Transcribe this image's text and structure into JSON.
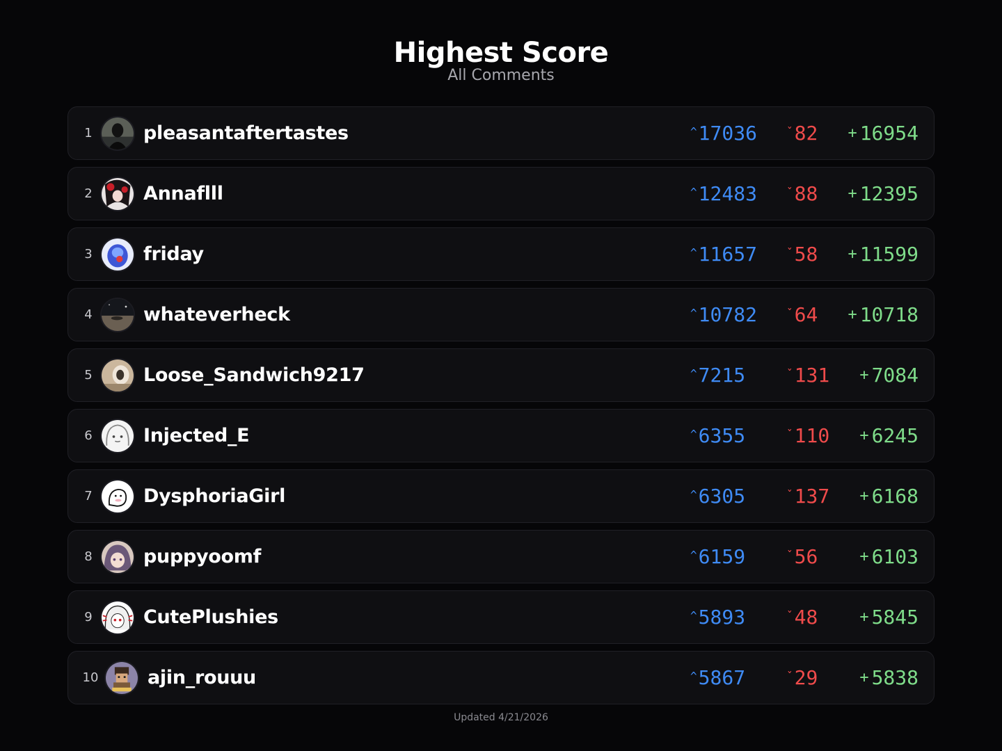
{
  "header": {
    "title": "Highest Score",
    "subtitle": "All Comments"
  },
  "entries": [
    {
      "rank": "1",
      "username": "pleasantaftertastes",
      "upvotes": "17036",
      "downvotes": "82",
      "net": "16954",
      "avatar_icon": "dark-figure-avatar"
    },
    {
      "rank": "2",
      "username": "Annaflll",
      "upvotes": "12483",
      "downvotes": "88",
      "net": "12395",
      "avatar_icon": "red-black-character-avatar"
    },
    {
      "rank": "3",
      "username": "friday",
      "upvotes": "11657",
      "downvotes": "58",
      "net": "11599",
      "avatar_icon": "blue-creature-avatar"
    },
    {
      "rank": "4",
      "username": "whateverheck",
      "upvotes": "10782",
      "downvotes": "64",
      "net": "10718",
      "avatar_icon": "night-landscape-avatar"
    },
    {
      "rank": "5",
      "username": "Loose_Sandwich9217",
      "upvotes": "7215",
      "downvotes": "131",
      "net": "7084",
      "avatar_icon": "beige-blur-avatar"
    },
    {
      "rank": "6",
      "username": "Injected_E",
      "upvotes": "6355",
      "downvotes": "110",
      "net": "6245",
      "avatar_icon": "sketch-girl-avatar"
    },
    {
      "rank": "7",
      "username": "DysphoriaGirl",
      "upvotes": "6305",
      "downvotes": "137",
      "net": "6168",
      "avatar_icon": "white-doodle-avatar"
    },
    {
      "rank": "8",
      "username": "puppyoomf",
      "upvotes": "6159",
      "downvotes": "56",
      "net": "6103",
      "avatar_icon": "anime-purple-hair-avatar"
    },
    {
      "rank": "9",
      "username": "CutePlushies",
      "upvotes": "5893",
      "downvotes": "48",
      "net": "5845",
      "avatar_icon": "white-hair-girl-avatar"
    },
    {
      "rank": "10",
      "username": "ajin_rouuu",
      "upvotes": "5867",
      "downvotes": "29",
      "net": "5838",
      "avatar_icon": "pixel-character-avatar"
    }
  ],
  "footer": {
    "updated": "Updated 4/21/2026"
  },
  "colors": {
    "upvote": "#3f8bf5",
    "downvote": "#ef4b4b",
    "net": "#7fdc8a",
    "row_bg": "#0f0f12",
    "page_bg": "#060608"
  }
}
